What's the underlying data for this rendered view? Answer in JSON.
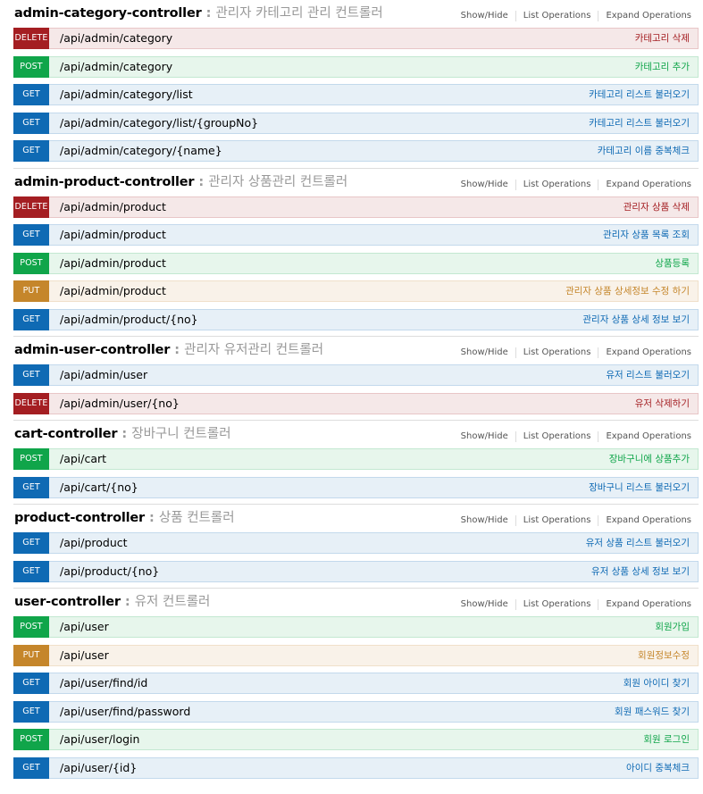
{
  "actions": {
    "show_hide": "Show/Hide",
    "list_operations": "List Operations",
    "expand_operations": "Expand Operations"
  },
  "colors": {
    "get": "#0f6ab4",
    "post": "#10a54a",
    "delete": "#a41e22",
    "put": "#c5862b"
  },
  "resources": [
    {
      "name": "admin-category-controller",
      "sep": " : ",
      "desc": "관리자 카테고리 관리 컨트롤러",
      "operations": [
        {
          "method": "DELETE",
          "path": "/api/admin/category",
          "summary": "카테고리 삭제"
        },
        {
          "method": "POST",
          "path": "/api/admin/category",
          "summary": "카테고리 추가"
        },
        {
          "method": "GET",
          "path": "/api/admin/category/list",
          "summary": "카테고리 리스트 불러오기"
        },
        {
          "method": "GET",
          "path": "/api/admin/category/list/{groupNo}",
          "summary": "카테고리 리스트 불러오기"
        },
        {
          "method": "GET",
          "path": "/api/admin/category/{name}",
          "summary": "카테고리 이름 중복체크"
        }
      ]
    },
    {
      "name": "admin-product-controller",
      "sep": " : ",
      "desc": "관리자 상품관리 컨트롤러",
      "operations": [
        {
          "method": "DELETE",
          "path": "/api/admin/product",
          "summary": "관리자 상품 삭제"
        },
        {
          "method": "GET",
          "path": "/api/admin/product",
          "summary": "관리자 상품 목록 조회"
        },
        {
          "method": "POST",
          "path": "/api/admin/product",
          "summary": "상품등록"
        },
        {
          "method": "PUT",
          "path": "/api/admin/product",
          "summary": "관리자 상품 상세정보 수정 하기"
        },
        {
          "method": "GET",
          "path": "/api/admin/product/{no}",
          "summary": "관리자 상품 상세 정보 보기"
        }
      ]
    },
    {
      "name": "admin-user-controller",
      "sep": " : ",
      "desc": "관리자 유저관리 컨트롤러",
      "operations": [
        {
          "method": "GET",
          "path": "/api/admin/user",
          "summary": "유저 리스트 불러오기"
        },
        {
          "method": "DELETE",
          "path": "/api/admin/user/{no}",
          "summary": "유저 삭제하기"
        }
      ]
    },
    {
      "name": "cart-controller",
      "sep": " : ",
      "desc": "장바구니 컨트롤러",
      "operations": [
        {
          "method": "POST",
          "path": "/api/cart",
          "summary": "장바구니에 상품추가"
        },
        {
          "method": "GET",
          "path": "/api/cart/{no}",
          "summary": "장바구니 리스트 불러오기"
        }
      ]
    },
    {
      "name": "product-controller",
      "sep": " : ",
      "desc": "상품 컨트롤러",
      "operations": [
        {
          "method": "GET",
          "path": "/api/product",
          "summary": "유저 상품 리스트 불러오기"
        },
        {
          "method": "GET",
          "path": "/api/product/{no}",
          "summary": "유저 상품 상세 정보 보기"
        }
      ]
    },
    {
      "name": "user-controller",
      "sep": " : ",
      "desc": "유저 컨트롤러",
      "operations": [
        {
          "method": "POST",
          "path": "/api/user",
          "summary": "회원가입"
        },
        {
          "method": "PUT",
          "path": "/api/user",
          "summary": "회원정보수정"
        },
        {
          "method": "GET",
          "path": "/api/user/find/id",
          "summary": "회원 아이디 찾기"
        },
        {
          "method": "GET",
          "path": "/api/user/find/password",
          "summary": "회원 패스워드 찾기"
        },
        {
          "method": "POST",
          "path": "/api/user/login",
          "summary": "회원 로그인"
        },
        {
          "method": "GET",
          "path": "/api/user/{id}",
          "summary": "아이디 중복체크"
        }
      ]
    }
  ]
}
